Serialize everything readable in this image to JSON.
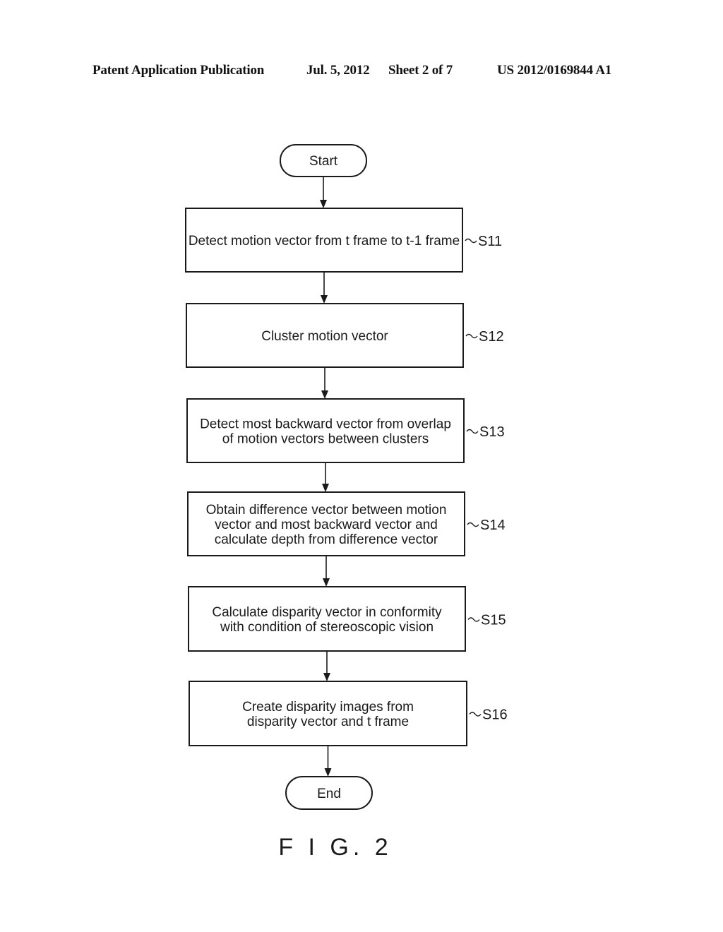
{
  "header": {
    "publication": "Patent Application Publication",
    "date": "Jul. 5, 2012",
    "sheet": "Sheet 2 of 7",
    "number": "US 2012/0169844 A1"
  },
  "flowchart": {
    "start": "Start",
    "end": "End",
    "steps": [
      {
        "id": "S11",
        "lines": [
          "Detect motion vector from t frame to t-1 frame"
        ]
      },
      {
        "id": "S12",
        "lines": [
          "Cluster motion vector"
        ]
      },
      {
        "id": "S13",
        "lines": [
          "Detect most backward vector from overlap",
          "of motion vectors between clusters"
        ]
      },
      {
        "id": "S14",
        "lines": [
          "Obtain difference vector between motion",
          "vector and most backward vector and",
          "calculate depth from difference vector"
        ]
      },
      {
        "id": "S15",
        "lines": [
          "Calculate disparity vector in conformity",
          "with condition of stereoscopic vision"
        ]
      },
      {
        "id": "S16",
        "lines": [
          "Create disparity images from",
          "disparity vector and t frame"
        ]
      }
    ]
  },
  "figure_label": "F I G. 2"
}
